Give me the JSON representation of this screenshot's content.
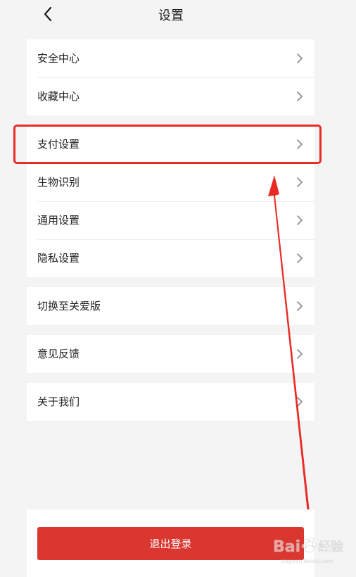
{
  "header": {
    "title": "设置",
    "back_icon": "chevron-left-icon"
  },
  "groups": {
    "account": {
      "items": [
        {
          "label": "安全中心"
        },
        {
          "label": "收藏中心"
        }
      ]
    },
    "settings": {
      "items": [
        {
          "label": "支付设置"
        },
        {
          "label": "生物识别"
        },
        {
          "label": "通用设置"
        },
        {
          "label": "隐私设置"
        }
      ]
    },
    "mode": {
      "items": [
        {
          "label": "切换至关爱版"
        }
      ]
    },
    "feedback": {
      "items": [
        {
          "label": "意见反馈"
        }
      ]
    },
    "about": {
      "items": [
        {
          "label": "关于我们"
        }
      ]
    }
  },
  "logout": {
    "label": "退出登录"
  },
  "annotation": {
    "highlight_color": "#ea2a24",
    "highlighted_item": "支付设置"
  },
  "colors": {
    "background": "#f4f4f4",
    "card": "#ffffff",
    "logout_button": "#db3731",
    "chevron": "#8a8a8a"
  },
  "watermark": {
    "logo": "baidu-jingyan-logo"
  }
}
